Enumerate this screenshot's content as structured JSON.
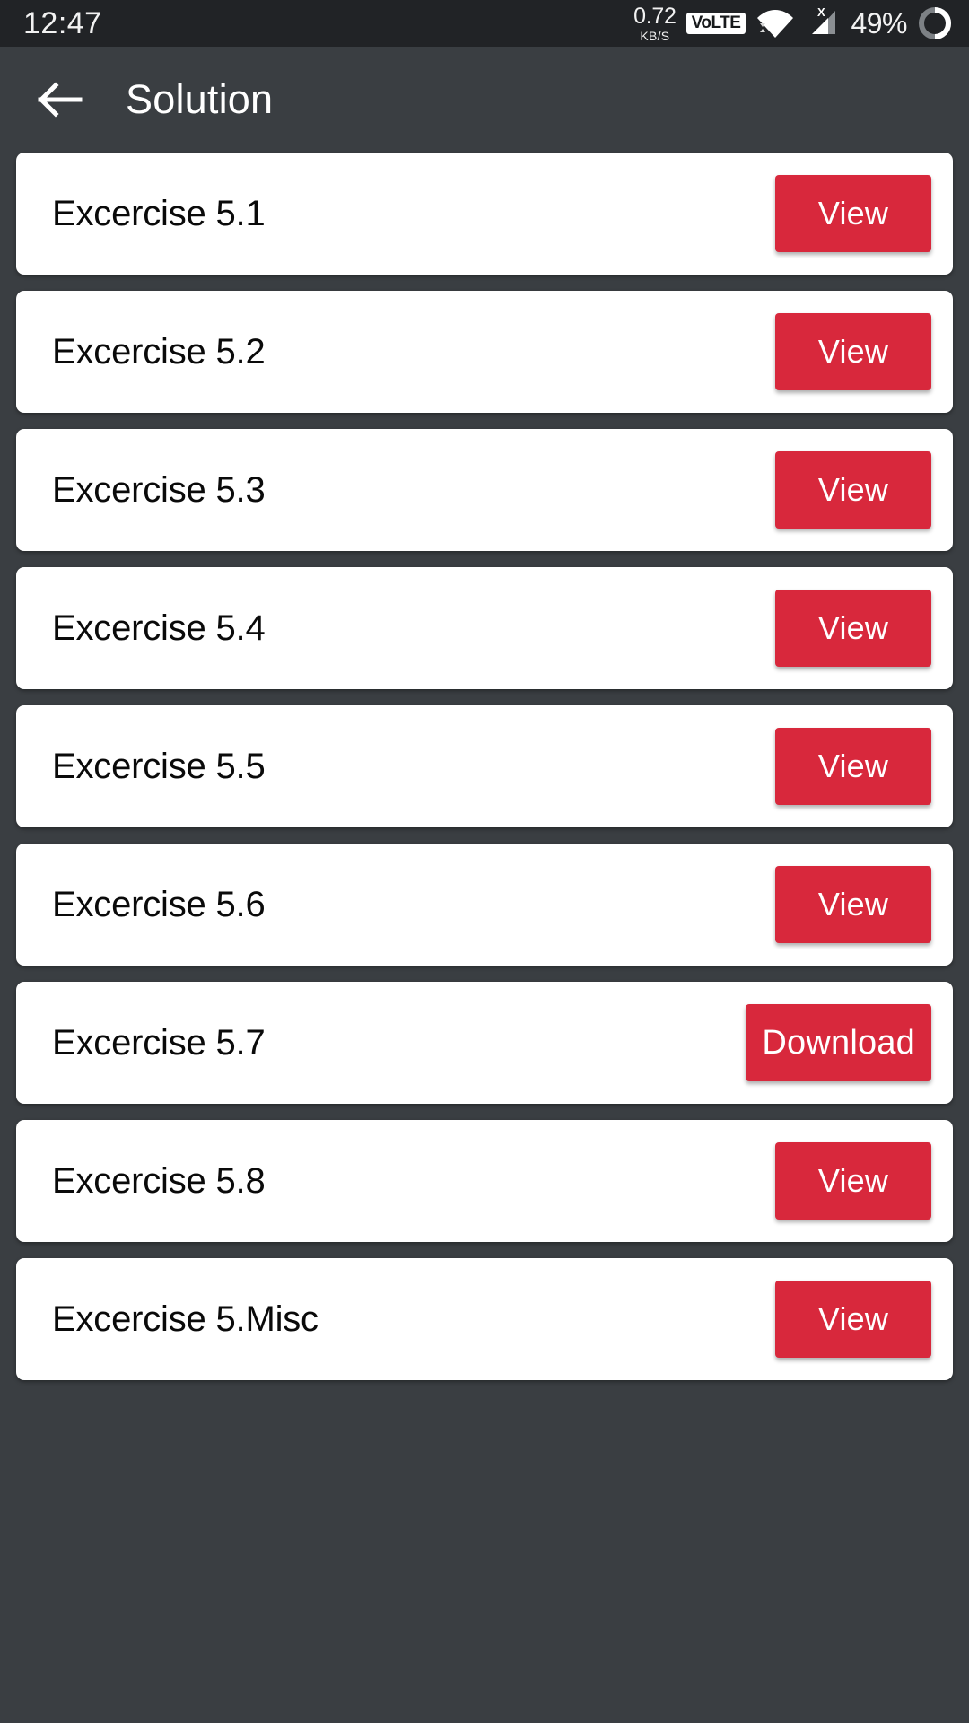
{
  "status_bar": {
    "time": "12:47",
    "network_speed_value": "0.72",
    "network_speed_unit": "KB/S",
    "volte_label": "VoLTE",
    "wifi_icon": "wifi-icon",
    "signal_icon": "signal-no-sim-icon",
    "signal_badge": "X",
    "battery_percent": "49%",
    "battery_icon": "battery-ring-icon",
    "background": "#212326"
  },
  "app_bar": {
    "back_icon": "back-arrow-icon",
    "title": "Solution",
    "background": "#3a3e42"
  },
  "theme": {
    "page_background": "#3a3e42",
    "card_background": "#ffffff",
    "accent_red": "#d8283c",
    "label_color": "#0a0a0a"
  },
  "list": {
    "items": [
      {
        "label": "Excercise 5.1",
        "action": "View"
      },
      {
        "label": "Excercise 5.2",
        "action": "View"
      },
      {
        "label": "Excercise 5.3",
        "action": "View"
      },
      {
        "label": "Excercise 5.4",
        "action": "View"
      },
      {
        "label": "Excercise 5.5",
        "action": "View"
      },
      {
        "label": "Excercise 5.6",
        "action": "View"
      },
      {
        "label": "Excercise 5.7",
        "action": "Download"
      },
      {
        "label": "Excercise 5.8",
        "action": "View"
      },
      {
        "label": "Excercise 5.Misc",
        "action": "View"
      }
    ]
  }
}
